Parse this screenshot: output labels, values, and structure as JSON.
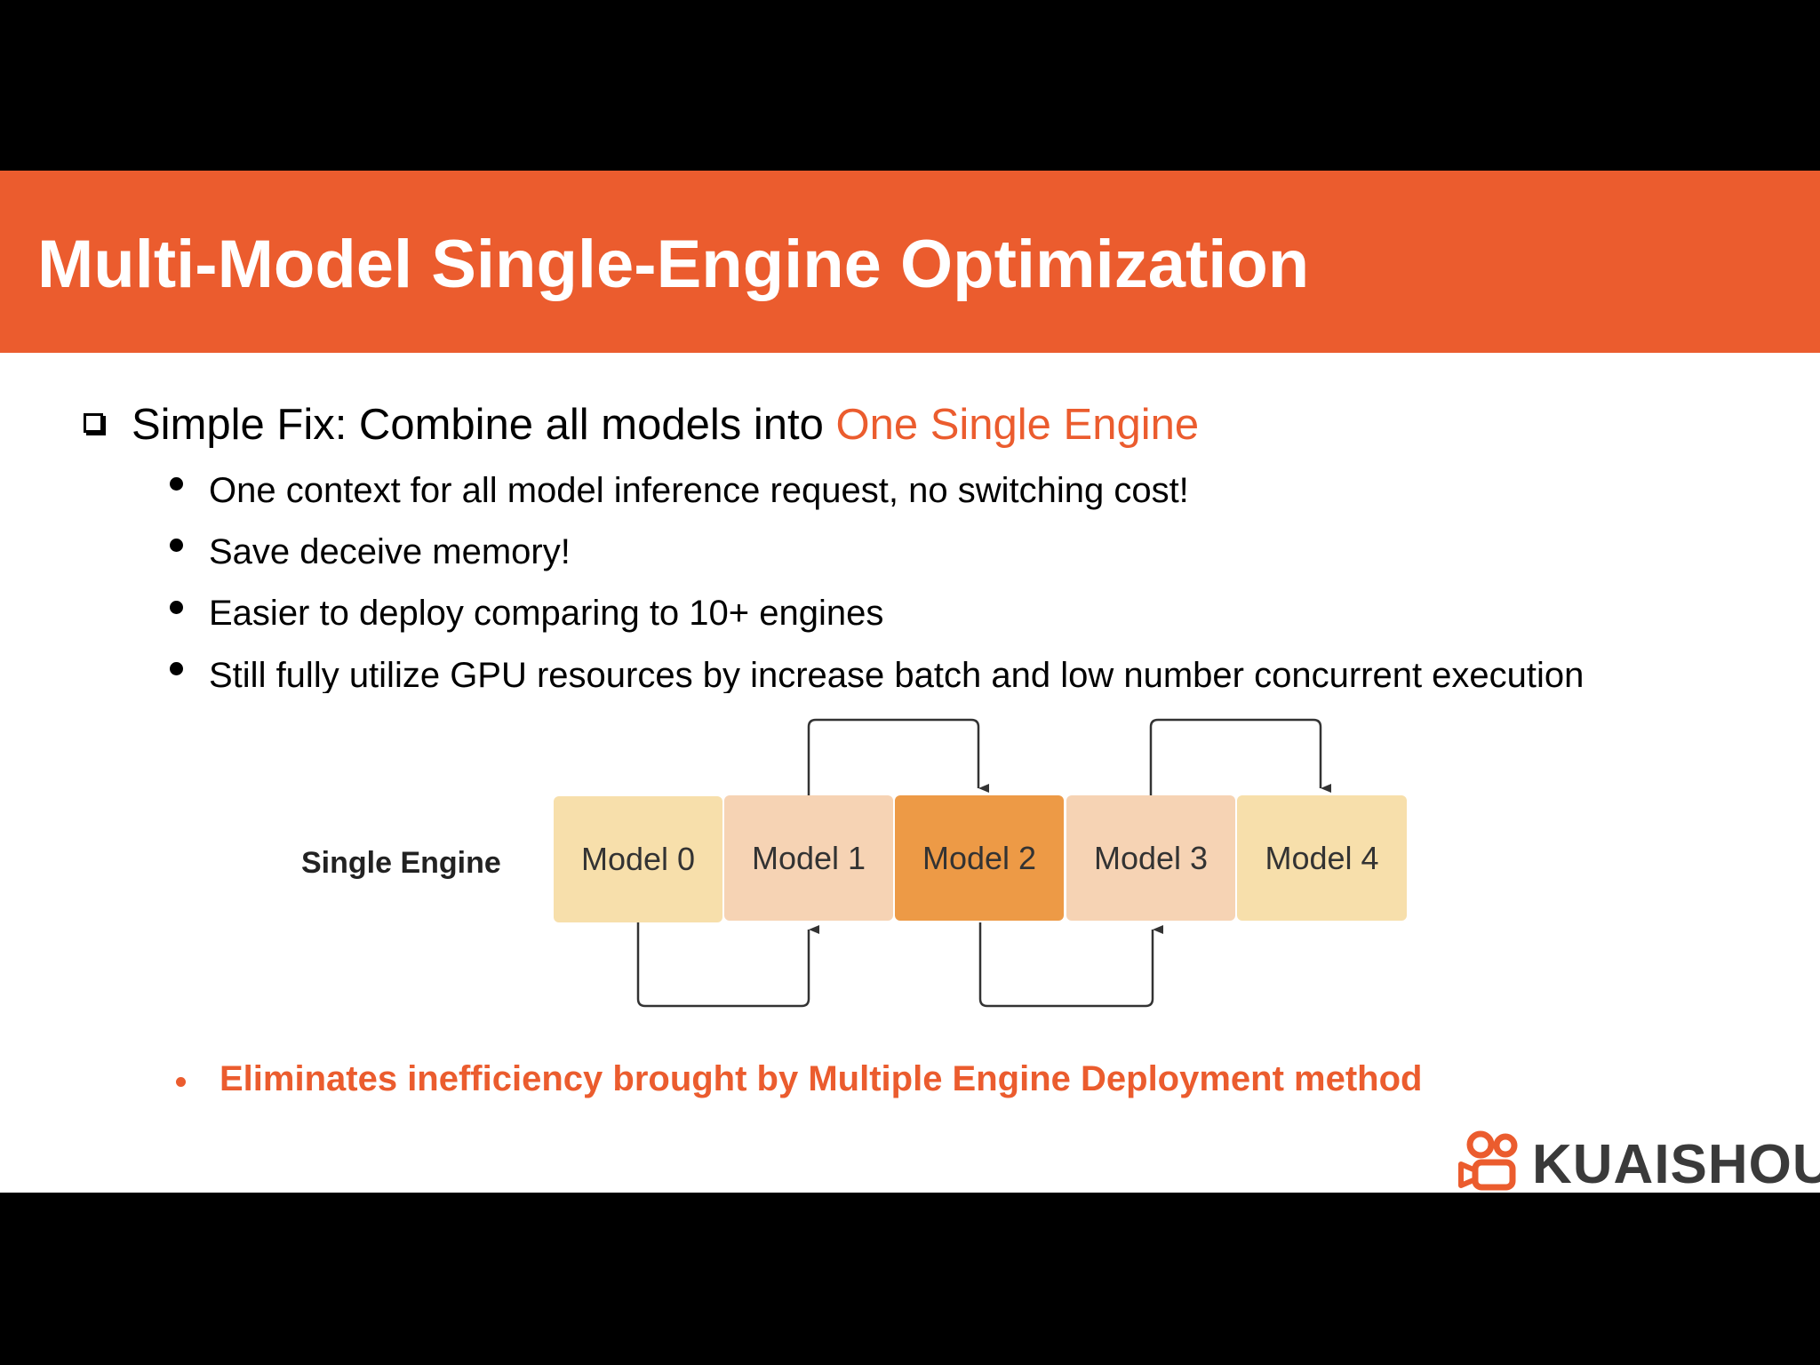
{
  "slide": {
    "title": "Multi-Model Single-Engine Optimization",
    "main_bullet": {
      "prefix": "Simple Fix: Combine all models into ",
      "highlight": "One Single Engine"
    },
    "sub_bullets": [
      "One context for all model inference request, no switching cost!",
      "Save deceive memory!",
      "Easier to deploy comparing to 10+ engines",
      "Still fully utilize GPU resources by increase batch and low number concurrent execution"
    ],
    "diagram": {
      "engine_label": "Single Engine",
      "models": [
        {
          "label": "Model 0",
          "color": "#f7dfab"
        },
        {
          "label": "Model 1",
          "color": "#f6d3b4"
        },
        {
          "label": "Model 2",
          "color": "#ed9a46"
        },
        {
          "label": "Model 3",
          "color": "#f6d3b4"
        },
        {
          "label": "Model 4",
          "color": "#f7dfab"
        }
      ]
    },
    "conclusion": "Eliminates inefficiency brought by Multiple Engine Deployment method",
    "logo": {
      "text": "KUAISHOU",
      "icon": "kuaishou-logo-icon"
    },
    "colors": {
      "accent": "#eb5c2e",
      "title_bar": "#eb5c2e"
    }
  }
}
